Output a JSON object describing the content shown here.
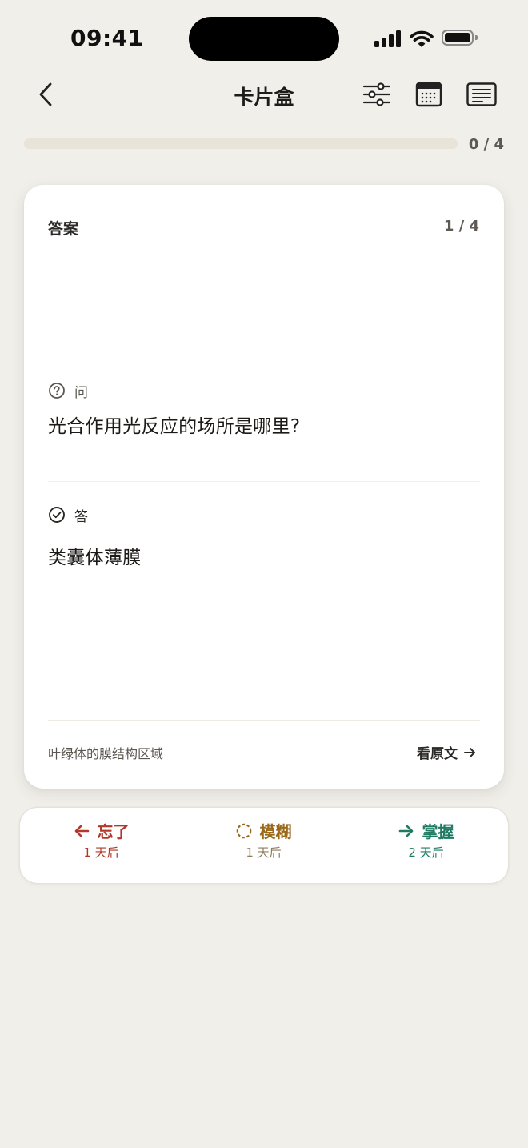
{
  "status_bar": {
    "time": "09:41"
  },
  "nav": {
    "title": "卡片盒"
  },
  "progress": {
    "text": "0 / 4",
    "fraction": 0
  },
  "card": {
    "label": "答案",
    "index": "1 / 4",
    "question_tag": "问",
    "question": "光合作用光反应的场所是哪里?",
    "answer_tag": "答",
    "answer": "类囊体薄膜",
    "note": "叶绿体的膜结构区域",
    "view_source": "看原文"
  },
  "rating": {
    "forget": {
      "label": "忘了",
      "interval": "1 天后",
      "color": "#b0392a"
    },
    "fuzzy": {
      "label": "模糊",
      "interval": "1 天后",
      "color": "#9a6a1a"
    },
    "master": {
      "label": "掌握",
      "interval": "2 天后",
      "color": "#1e7b62"
    }
  },
  "icons": [
    "back-chevron-icon",
    "filter-sliders-icon",
    "calendar-icon",
    "list-icon",
    "question-circle-icon",
    "check-circle-icon",
    "arrow-right-icon",
    "arrow-left-icon",
    "dashed-circle-icon"
  ]
}
